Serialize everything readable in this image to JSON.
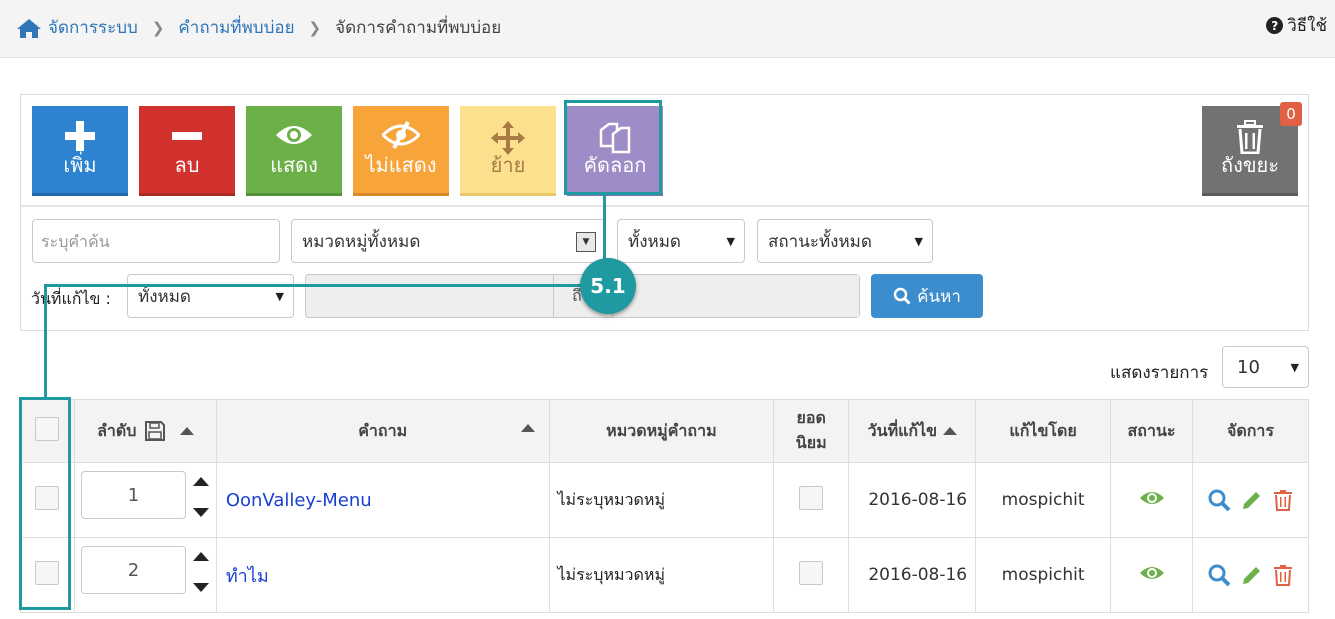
{
  "breadcrumb": {
    "items": [
      "จัดการระบบ",
      "คำถามที่พบบ่อย"
    ],
    "current": "จัดการคำถามที่พบบ่อย"
  },
  "help": {
    "label": "วิธีใช้"
  },
  "toolbar": {
    "add_label": "เพิ่ม",
    "delete_label": "ลบ",
    "show_label": "แสดง",
    "hide_label": "ไม่แสดง",
    "move_label": "ย้าย",
    "copy_label": "คัดลอก",
    "trash_label": "ถังขยะ",
    "trash_count": "0"
  },
  "filters": {
    "search_placeholder": "ระบุคำค้น",
    "category_value": "หมวดหมู่ทั้งหมด",
    "all_value": "ทั้งหมด",
    "status_value": "สถานะทั้งหมด",
    "date_label": "วันที่แก้ไข :",
    "date_value": "ทั้งหมด",
    "date_to_label": "ถึ",
    "search_button": "ค้นหา"
  },
  "pagination": {
    "show_label": "แสดงรายการ",
    "page_size": "10"
  },
  "table": {
    "headers": {
      "order": "ลำดับ",
      "question": "คำถาม",
      "category": "หมวดหมู่คำถาม",
      "popular_1": "ยอด",
      "popular_2": "นิยม",
      "date": "วันที่แก้ไข",
      "edited_by": "แก้ไขโดย",
      "status": "สถานะ",
      "actions": "จัดการ"
    },
    "rows": [
      {
        "order": "1",
        "question": "OonValley-Menu",
        "category": "ไม่ระบุหมวดหมู่",
        "date": "2016-08-16",
        "edited_by": "mospichit"
      },
      {
        "order": "2",
        "question": "ทำไม",
        "category": "ไม่ระบุหมวดหมู่",
        "date": "2016-08-16",
        "edited_by": "mospichit"
      }
    ]
  },
  "annotation": {
    "callout_label": "5.1"
  },
  "colors": {
    "accent": "#1f9aa0",
    "link": "#1a3fd1",
    "brand": "#2f76b8"
  }
}
